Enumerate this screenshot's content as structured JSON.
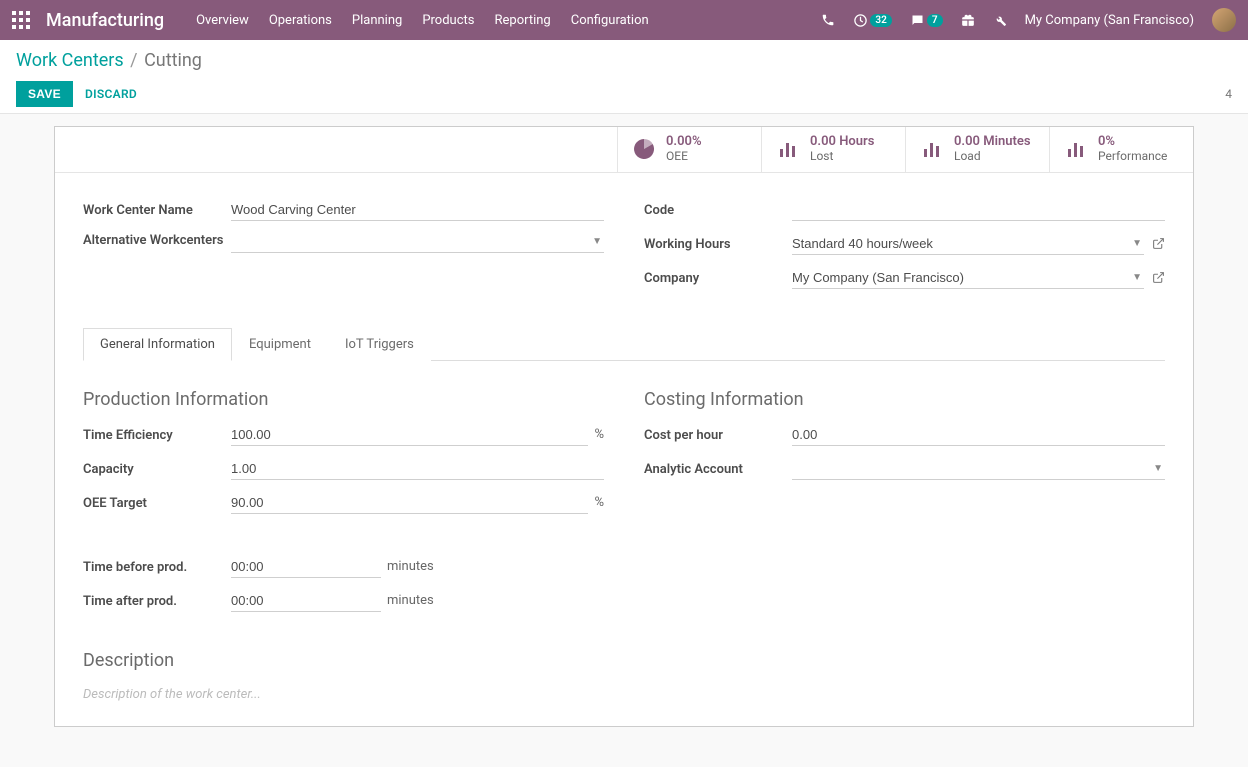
{
  "topbar": {
    "app_title": "Manufacturing",
    "menu": [
      "Overview",
      "Operations",
      "Planning",
      "Products",
      "Reporting",
      "Configuration"
    ],
    "badges": {
      "activities": "32",
      "messages": "7"
    },
    "company": "My Company (San Francisco)"
  },
  "breadcrumb": {
    "parent": "Work Centers",
    "current": "Cutting"
  },
  "buttons": {
    "save": "SAVE",
    "discard": "DISCARD"
  },
  "pager": {
    "text": "4"
  },
  "stats": {
    "oee": {
      "value": "0.00%",
      "label": "OEE"
    },
    "lost": {
      "value": "0.00 Hours",
      "label": "Lost"
    },
    "load": {
      "value": "0.00 Minutes",
      "label": "Load"
    },
    "performance": {
      "value": "0%",
      "label": "Performance"
    }
  },
  "fields": {
    "name_label": "Work Center Name",
    "name_value": "Wood Carving Center",
    "alt_label": "Alternative Workcenters",
    "alt_value": "",
    "code_label": "Code",
    "code_value": "",
    "hours_label": "Working Hours",
    "hours_value": "Standard 40 hours/week",
    "company_label": "Company",
    "company_value": "My Company (San Francisco)"
  },
  "tabs": {
    "general": "General Information",
    "equipment": "Equipment",
    "iot": "IoT Triggers"
  },
  "prod": {
    "heading": "Production Information",
    "time_eff_label": "Time Efficiency",
    "time_eff_value": "100.00",
    "capacity_label": "Capacity",
    "capacity_value": "1.00",
    "oee_target_label": "OEE Target",
    "oee_target_value": "90.00",
    "time_before_label": "Time before prod.",
    "time_before_value": "00:00",
    "time_after_label": "Time after prod.",
    "time_after_value": "00:00",
    "percent_unit": "%",
    "minutes_unit": "minutes"
  },
  "cost": {
    "heading": "Costing Information",
    "cost_label": "Cost per hour",
    "cost_value": "0.00",
    "analytic_label": "Analytic Account",
    "analytic_value": ""
  },
  "desc": {
    "heading": "Description",
    "placeholder": "Description of the work center..."
  }
}
